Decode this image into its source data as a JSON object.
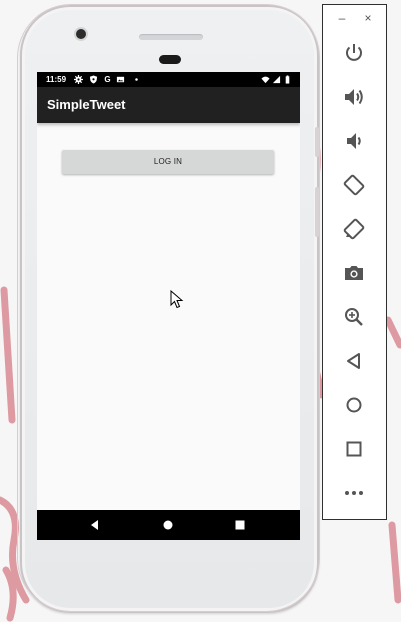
{
  "phone": {
    "status_bar": {
      "time": "11:59",
      "left_icons": [
        "settings-gear-icon",
        "shield-icon",
        "google-g-icon",
        "image-icon",
        "dot-icon"
      ],
      "right_icons": [
        "wifi-icon",
        "signal-icon",
        "battery-icon"
      ],
      "google_glyph": "G"
    },
    "app_bar": {
      "title": "SimpleTweet"
    },
    "main": {
      "login_button_label": "LOG IN"
    },
    "nav_bar": {
      "buttons": [
        "back-icon",
        "home-icon",
        "recents-icon"
      ]
    }
  },
  "emulator_toolbar": {
    "window_controls": {
      "minimize": "–",
      "close": "×"
    },
    "buttons": [
      "power-icon",
      "volume-up-icon",
      "volume-down-icon",
      "rotate-left-icon",
      "rotate-right-icon",
      "camera-icon",
      "zoom-icon",
      "back-icon",
      "home-icon",
      "overview-icon",
      "more-icon"
    ]
  },
  "colors": {
    "app_bar": "#212121",
    "status_bar": "#000000",
    "screen_bg": "#fafafa",
    "button_bg": "#d6d7d7",
    "scribble": "#d98a93"
  }
}
